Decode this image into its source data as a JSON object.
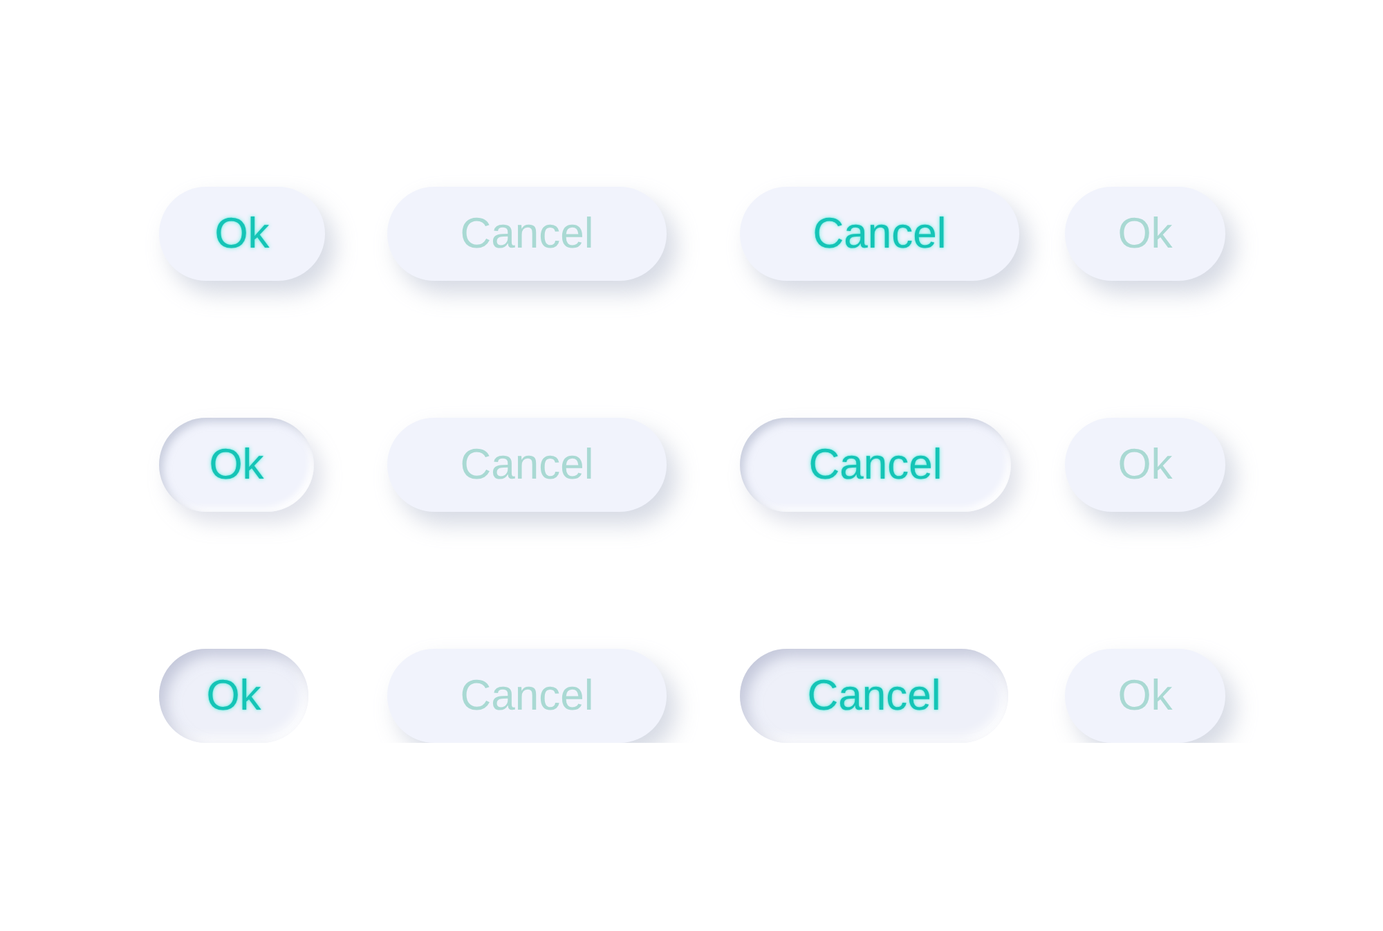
{
  "rows": [
    {
      "buttons": [
        {
          "label": "Ok",
          "highlighted": true,
          "kind": "raised"
        },
        {
          "label": "Cancel",
          "highlighted": false,
          "kind": "raised"
        },
        {
          "label": "Cancel",
          "highlighted": true,
          "kind": "raised"
        },
        {
          "label": "Ok",
          "highlighted": false,
          "kind": "raised"
        }
      ]
    },
    {
      "buttons": [
        {
          "label": "Ok",
          "highlighted": true,
          "kind": "pressed"
        },
        {
          "label": "Cancel",
          "highlighted": false,
          "kind": "raised"
        },
        {
          "label": "Cancel",
          "highlighted": true,
          "kind": "pressed"
        },
        {
          "label": "Ok",
          "highlighted": false,
          "kind": "raised"
        }
      ]
    },
    {
      "buttons": [
        {
          "label": "Ok",
          "highlighted": true,
          "kind": "sunken"
        },
        {
          "label": "Cancel",
          "highlighted": false,
          "kind": "raised"
        },
        {
          "label": "Cancel",
          "highlighted": true,
          "kind": "sunken"
        },
        {
          "label": "Ok",
          "highlighted": false,
          "kind": "raised"
        }
      ]
    }
  ]
}
